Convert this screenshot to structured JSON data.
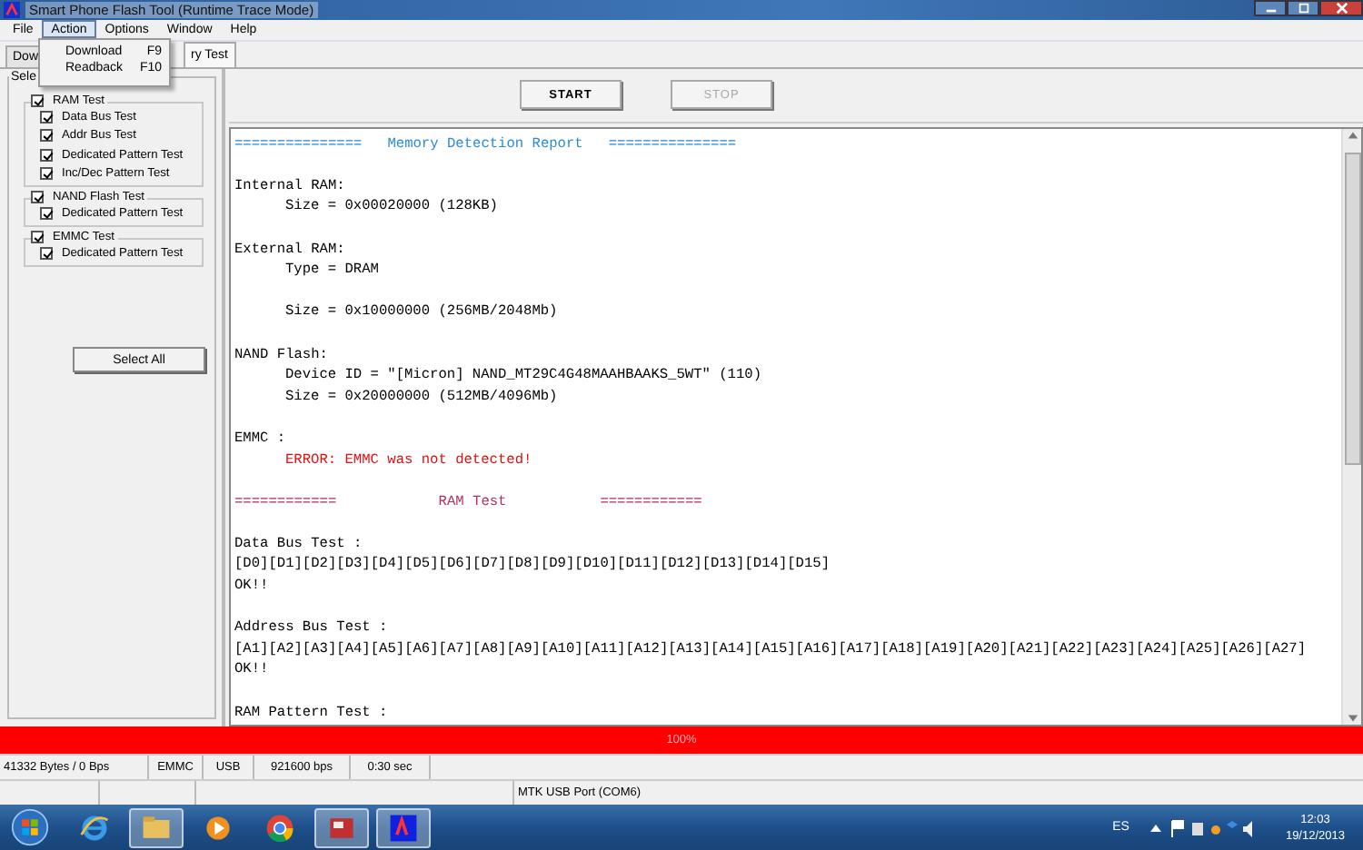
{
  "window": {
    "title": "Smart Phone Flash Tool (Runtime Trace Mode)"
  },
  "menu": [
    {
      "label": "File",
      "selected": false
    },
    {
      "label": "Action",
      "selected": true
    },
    {
      "label": "Options",
      "selected": false
    },
    {
      "label": "Window",
      "selected": false
    },
    {
      "label": "Help",
      "selected": false
    }
  ],
  "open_menu": {
    "items": [
      {
        "label": "Download",
        "shortcut": "F9"
      },
      {
        "label": "Readback",
        "shortcut": "F10"
      }
    ]
  },
  "tabs": [
    {
      "label": "Dow",
      "selected": false
    },
    {
      "label": "ry Test",
      "selected": true
    }
  ],
  "selection_group": {
    "title": "Sele",
    "groups": [
      {
        "label": "RAM Test",
        "checked": true,
        "children": [
          {
            "label": "Data Bus Test",
            "checked": true
          },
          {
            "label": "Addr Bus Test",
            "checked": true
          },
          {
            "label": "Dedicated Pattern Test",
            "checked": true
          },
          {
            "label": "Inc/Dec Pattern Test",
            "checked": true
          }
        ]
      },
      {
        "label": "NAND Flash Test",
        "checked": true,
        "children": [
          {
            "label": "Dedicated Pattern Test",
            "checked": true
          }
        ]
      },
      {
        "label": "EMMC Test",
        "checked": true,
        "children": [
          {
            "label": "Dedicated Pattern Test",
            "checked": true
          }
        ]
      }
    ],
    "select_all": "Select All"
  },
  "toolbar": [
    {
      "label": "START",
      "disabled": false
    },
    {
      "label": "STOP",
      "disabled": true
    }
  ],
  "report": [
    [
      {
        "kind": "heading",
        "text": "===============   Memory Detection Report   ==============="
      }
    ],
    [
      {
        "kind": "text",
        "text": "Internal RAM:",
        "children": [
          {
            "kind": "text",
            "text": "Size = 0x00020000 (128KB)"
          }
        ]
      }
    ],
    [
      {
        "kind": "text",
        "text": "External RAM:",
        "children": [
          {
            "kind": "text",
            "text": "Type = DRAM"
          },
          {
            "kind": "text",
            "text": "Size = 0x10000000 (256MB/2048Mb)",
            "gap_before": true
          }
        ]
      }
    ],
    [
      {
        "kind": "text",
        "text": "NAND Flash:",
        "children": [
          {
            "kind": "text",
            "text": "Device ID = \"[Micron] NAND_MT29C4G48MAAHBAAKS_5WT\" (110)"
          },
          {
            "kind": "text",
            "text": "Size = 0x20000000 (512MB/4096Mb)"
          }
        ]
      }
    ],
    [
      {
        "kind": "text",
        "text": "EMMC :",
        "children": [
          {
            "kind": "error",
            "text": "ERROR: EMMC was not detected!"
          }
        ]
      }
    ],
    [
      {
        "kind": "section",
        "text": "============            RAM Test           ============"
      }
    ],
    [
      {
        "kind": "text",
        "text": "Data Bus Test :"
      },
      {
        "kind": "text",
        "text": "[D0][D1][D2][D3][D4][D5][D6][D7][D8][D9][D10][D11][D12][D13][D14][D15]"
      },
      {
        "kind": "text",
        "text": "OK!!"
      }
    ],
    [
      {
        "kind": "text",
        "text": "Address Bus Test :"
      },
      {
        "kind": "text",
        "text": "[A1][A2][A3][A4][A5][A6][A7][A8][A9][A10][A11][A12][A13][A14][A15][A16][A17][A18][A19][A20][A21][A22][A23][A24][A25][A26][A27]"
      },
      {
        "kind": "text",
        "text": "OK!!"
      }
    ],
    [
      {
        "kind": "text",
        "text": "RAM Pattern Test :"
      }
    ]
  ],
  "progress": {
    "level": 1,
    "label": "100%"
  },
  "status_bar": {
    "row_1": [
      "41332 Bytes / 0 Bps",
      "EMMC",
      "USB",
      "921600 bps",
      "0:30 sec"
    ],
    "row_2": [
      "MTK USB Port (COM6)"
    ]
  },
  "taskbar": {
    "apps": [
      {
        "kind": "ie",
        "selected": false
      },
      {
        "kind": "folder",
        "selected": true
      },
      {
        "kind": "media",
        "selected": false
      },
      {
        "kind": "chrome",
        "selected": false
      },
      {
        "kind": "tool",
        "selected": true
      },
      {
        "kind": "flash",
        "selected": true
      }
    ],
    "language": "ES",
    "time": "12:03",
    "date": "19/12/2013"
  }
}
